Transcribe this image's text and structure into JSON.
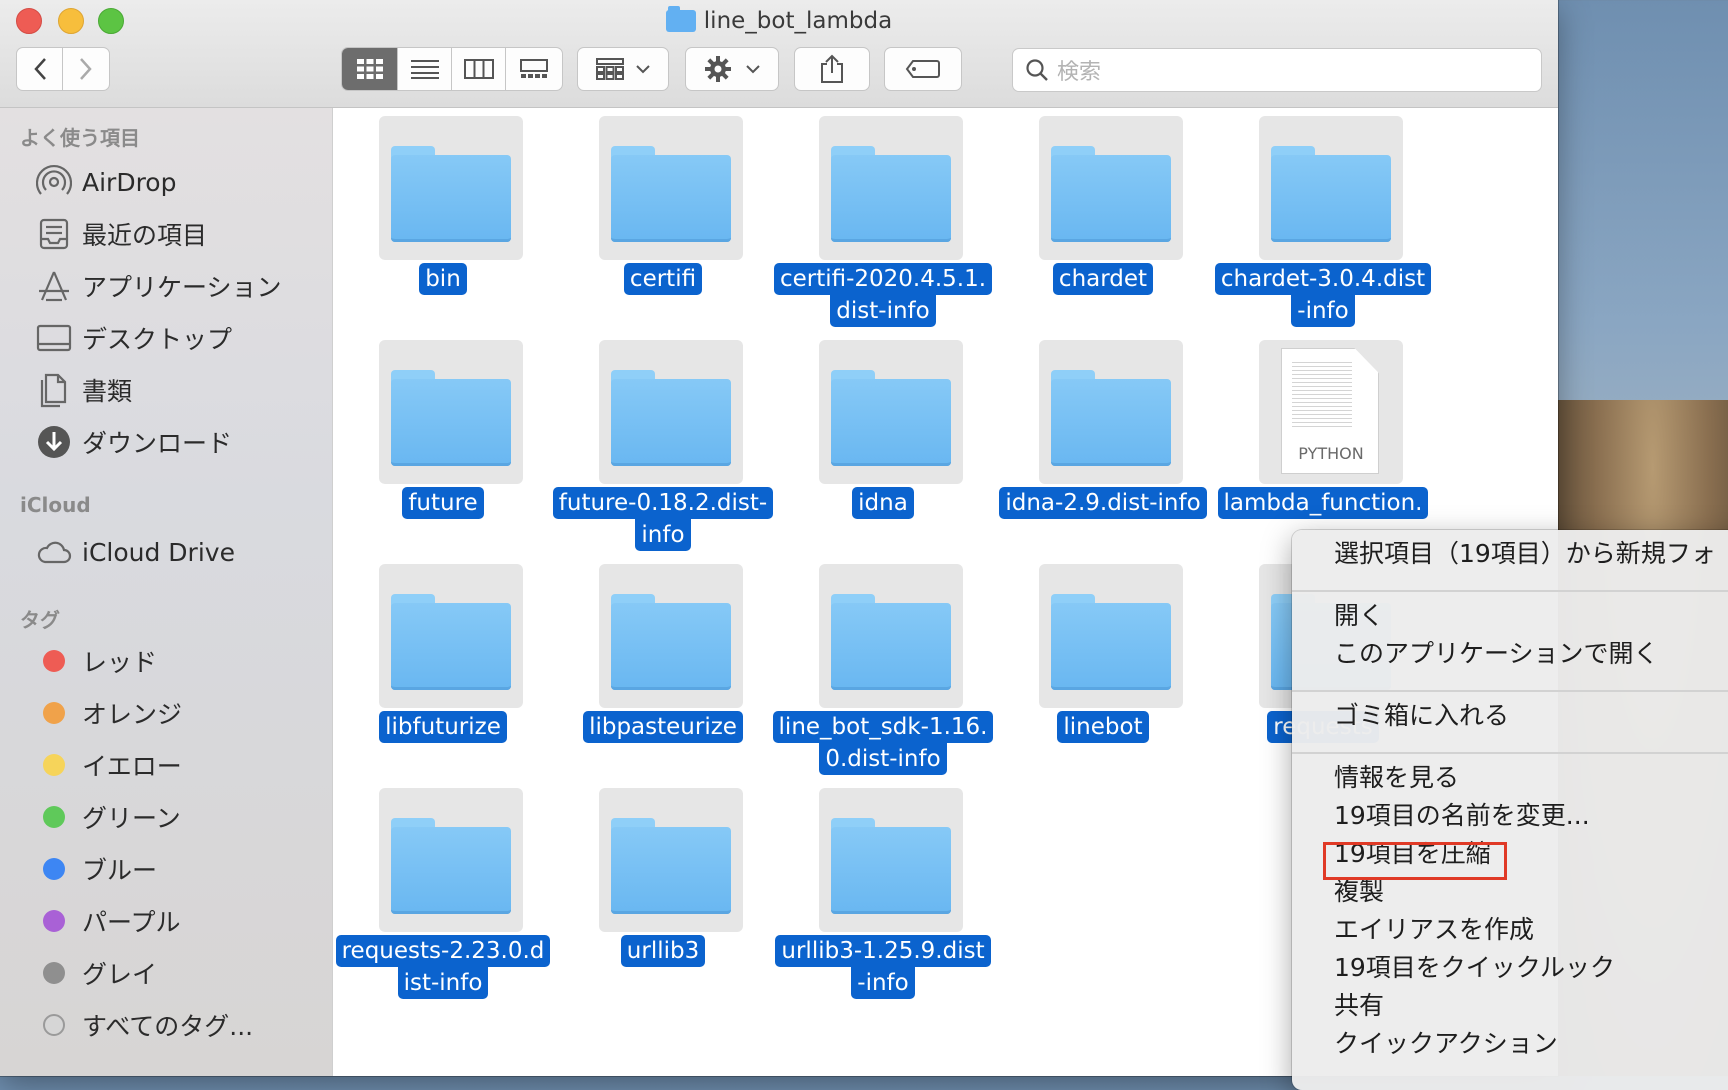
{
  "window": {
    "title": "line_bot_lambda"
  },
  "toolbar": {
    "search_placeholder": "検索",
    "back_icon": "chevron-left-icon",
    "forward_icon": "chevron-right-icon"
  },
  "sidebar": {
    "favorites_header": "よく使う項目",
    "favorites": [
      {
        "label": "AirDrop",
        "icon": "airdrop-icon"
      },
      {
        "label": "最近の項目",
        "icon": "recents-icon"
      },
      {
        "label": "アプリケーション",
        "icon": "applications-icon"
      },
      {
        "label": "デスクトップ",
        "icon": "desktop-icon"
      },
      {
        "label": "書類",
        "icon": "documents-icon"
      },
      {
        "label": "ダウンロード",
        "icon": "downloads-icon"
      }
    ],
    "icloud_header": "iCloud",
    "icloud": [
      {
        "label": "iCloud Drive",
        "icon": "cloud-icon"
      }
    ],
    "tags_header": "タグ",
    "tags": [
      {
        "label": "レッド",
        "color": "#ee5c54"
      },
      {
        "label": "オレンジ",
        "color": "#f0a24a"
      },
      {
        "label": "イエロー",
        "color": "#f6d45a"
      },
      {
        "label": "グリーン",
        "color": "#5fc95a"
      },
      {
        "label": "ブルー",
        "color": "#3d86f3"
      },
      {
        "label": "パープル",
        "color": "#a961d6"
      },
      {
        "label": "グレイ",
        "color": "#8f8f8f"
      },
      {
        "label": "すべてのタグ...",
        "color": "#cfcfcf"
      }
    ]
  },
  "files": [
    {
      "lines": [
        "bin"
      ],
      "kind": "folder"
    },
    {
      "lines": [
        "certifi"
      ],
      "kind": "folder"
    },
    {
      "lines": [
        "certifi-2020.4.5.1.",
        "dist-info"
      ],
      "kind": "folder"
    },
    {
      "lines": [
        "chardet"
      ],
      "kind": "folder"
    },
    {
      "lines": [
        "chardet-3.0.4.dist",
        "-info"
      ],
      "kind": "folder"
    },
    {
      "lines": [
        "future"
      ],
      "kind": "folder"
    },
    {
      "lines": [
        "future-0.18.2.dist-",
        "info"
      ],
      "kind": "folder"
    },
    {
      "lines": [
        "idna"
      ],
      "kind": "folder"
    },
    {
      "lines": [
        "idna-2.9.dist-info"
      ],
      "kind": "folder"
    },
    {
      "lines": [
        "lambda_function."
      ],
      "kind": "python",
      "doc_label": "PYTHON"
    },
    {
      "lines": [
        "libfuturize"
      ],
      "kind": "folder"
    },
    {
      "lines": [
        "libpasteurize"
      ],
      "kind": "folder"
    },
    {
      "lines": [
        "line_bot_sdk-1.16.",
        "0.dist-info"
      ],
      "kind": "folder"
    },
    {
      "lines": [
        "linebot"
      ],
      "kind": "folder"
    },
    {
      "lines": [
        "requests"
      ],
      "kind": "folder"
    },
    {
      "lines": [
        "requests-2.23.0.d",
        "ist-info"
      ],
      "kind": "folder"
    },
    {
      "lines": [
        "urllib3"
      ],
      "kind": "folder"
    },
    {
      "lines": [
        "urllib3-1.25.9.dist",
        "-info"
      ],
      "kind": "folder"
    }
  ],
  "context_menu": {
    "items": [
      "選択項目（19項目）から新規フォ",
      "開く",
      "このアプリケーションで開く",
      "ゴミ箱に入れる",
      "情報を見る",
      "19項目の名前を変更...",
      "19項目を圧縮",
      "複製",
      "エイリアスを作成",
      "19項目をクイックルック",
      "共有",
      "クイックアクション"
    ],
    "highlight_color": "#e03a26"
  }
}
